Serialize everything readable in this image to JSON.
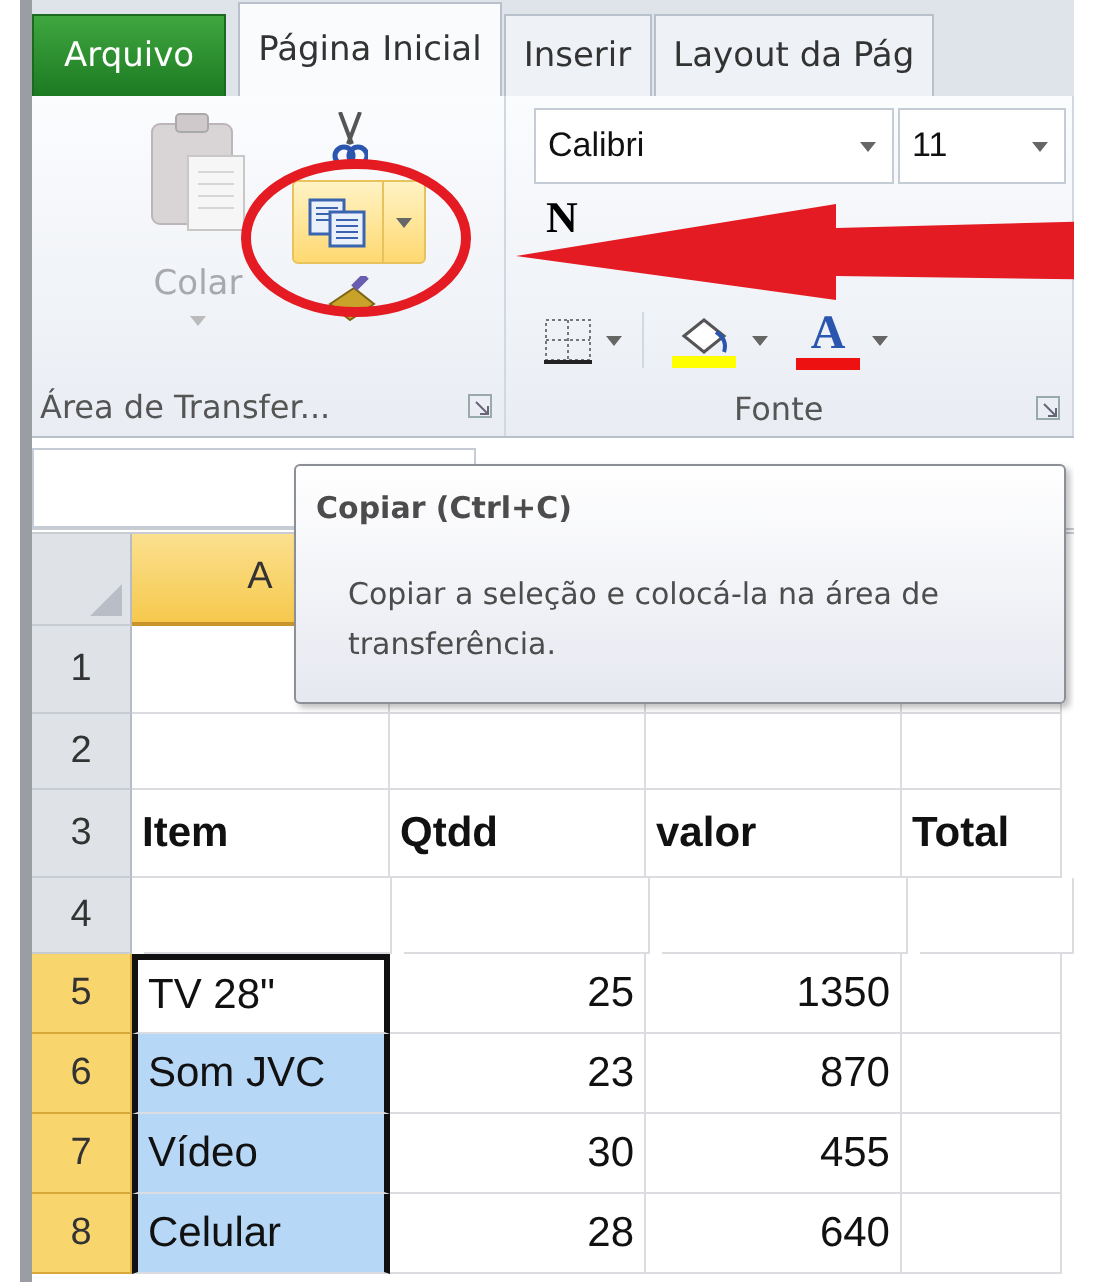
{
  "tabs": [
    {
      "label": "Arquivo",
      "kind": "file",
      "selected": false
    },
    {
      "label": "Página Inicial",
      "kind": "tab",
      "selected": true
    },
    {
      "label": "Inserir",
      "kind": "tab",
      "selected": false
    },
    {
      "label": "Layout da Pág",
      "kind": "tab",
      "selected": false
    }
  ],
  "clipboard": {
    "paste_label": "Colar",
    "paste_disabled": true,
    "copy_highlighted": true,
    "group_label": "Área de Transfer..."
  },
  "font": {
    "font_name": "Calibri",
    "font_size": "11",
    "bold_label": "N",
    "font_color_label": "A",
    "group_label": "Fonte"
  },
  "tooltip": {
    "title": "Copiar (Ctrl+C)",
    "description": "Copiar a seleção e colocá-la na área de transferência."
  },
  "sheet": {
    "columns": [
      {
        "label": "A",
        "selected": true
      }
    ],
    "rows": [
      {
        "number": "1",
        "selected": false,
        "kind": "plain",
        "cells": []
      },
      {
        "number": "2",
        "selected": false,
        "kind": "plain",
        "cells": []
      },
      {
        "number": "3",
        "selected": false,
        "kind": "header",
        "cells": [
          {
            "text": "Item",
            "kind": "text",
            "selected": false,
            "active": false
          },
          {
            "text": "Qtdd",
            "kind": "text",
            "selected": false,
            "active": false
          },
          {
            "text": "valor",
            "kind": "text",
            "selected": false,
            "active": false
          },
          {
            "text": "Total",
            "kind": "text",
            "selected": false,
            "active": false
          }
        ]
      },
      {
        "number": "4",
        "selected": false,
        "kind": "plain",
        "cells": []
      },
      {
        "number": "5",
        "selected": true,
        "kind": "plain",
        "cells": [
          {
            "text": "TV 28\"",
            "kind": "text",
            "selected": true,
            "active": true
          },
          {
            "text": "25",
            "kind": "number",
            "selected": false,
            "active": false
          },
          {
            "text": "1350",
            "kind": "number",
            "selected": false,
            "active": false
          }
        ]
      },
      {
        "number": "6",
        "selected": true,
        "kind": "plain",
        "cells": [
          {
            "text": "Som JVC",
            "kind": "text",
            "selected": true,
            "active": false
          },
          {
            "text": "23",
            "kind": "number",
            "selected": false,
            "active": false
          },
          {
            "text": "870",
            "kind": "number",
            "selected": false,
            "active": false
          }
        ]
      },
      {
        "number": "7",
        "selected": true,
        "kind": "plain",
        "cells": [
          {
            "text": "Vídeo",
            "kind": "text",
            "selected": true,
            "active": false
          },
          {
            "text": "30",
            "kind": "number",
            "selected": false,
            "active": false
          },
          {
            "text": "455",
            "kind": "number",
            "selected": false,
            "active": false
          }
        ]
      },
      {
        "number": "8",
        "selected": true,
        "kind": "plain",
        "cells": [
          {
            "text": "Celular",
            "kind": "text",
            "selected": true,
            "active": false
          },
          {
            "text": "28",
            "kind": "number",
            "selected": false,
            "active": false
          },
          {
            "text": "640",
            "kind": "number",
            "selected": false,
            "active": false
          }
        ]
      }
    ]
  }
}
